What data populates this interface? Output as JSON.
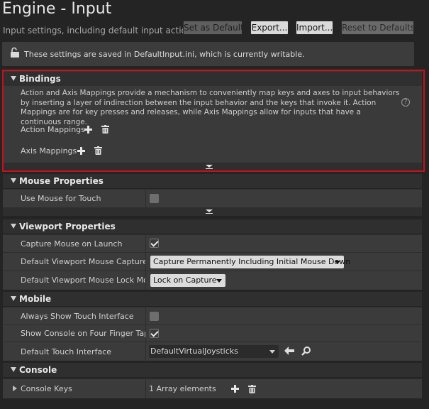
{
  "header": {
    "title": "Engine - Input",
    "subtitle": "Input settings, including default input action",
    "buttons": {
      "set_default": "Set as Default",
      "export": "Export...",
      "import": "Import...",
      "reset": "Reset to Defaults"
    }
  },
  "notice": {
    "text": "These settings are saved in DefaultInput.ini, which is currently writable.",
    "icon": "unlock-icon"
  },
  "bindings": {
    "header": "Bindings",
    "description": "Action and Axis Mappings provide a mechanism to conveniently map keys and axes to input behaviors by inserting a layer of indirection between the input behavior and the keys that invoke it. Action Mappings are for key presses and releases, while Axis Mappings allow for inputs that have a continuous range.",
    "help_icon": "?",
    "action_mappings": "Action Mappings",
    "axis_mappings": "Axis Mappings"
  },
  "mouse": {
    "header": "Mouse Properties",
    "use_mouse_for_touch": {
      "label": "Use Mouse for Touch",
      "checked": false
    }
  },
  "viewport": {
    "header": "Viewport Properties",
    "capture_mouse": {
      "label": "Capture Mouse on Launch",
      "checked": true
    },
    "capture_mode": {
      "label": "Default Viewport Mouse Capture M",
      "value": "Capture Permanently Including Initial Mouse Down"
    },
    "lock_mode": {
      "label": "Default Viewport Mouse Lock Mode",
      "value": "Lock on Capture"
    }
  },
  "mobile": {
    "header": "Mobile",
    "always_show_touch": {
      "label": "Always Show Touch Interface",
      "checked": false
    },
    "show_console": {
      "label": "Show Console on Four Finger Tap",
      "checked": true
    },
    "touch_interface": {
      "label": "Default Touch Interface",
      "value": "DefaultVirtualJoysticks"
    }
  },
  "console": {
    "header": "Console",
    "console_keys": {
      "label": "Console Keys",
      "value": "1 Array elements"
    }
  },
  "colors": {
    "background": "#242424",
    "highlight_border": "#c8101a",
    "button_light": "#dadada"
  }
}
